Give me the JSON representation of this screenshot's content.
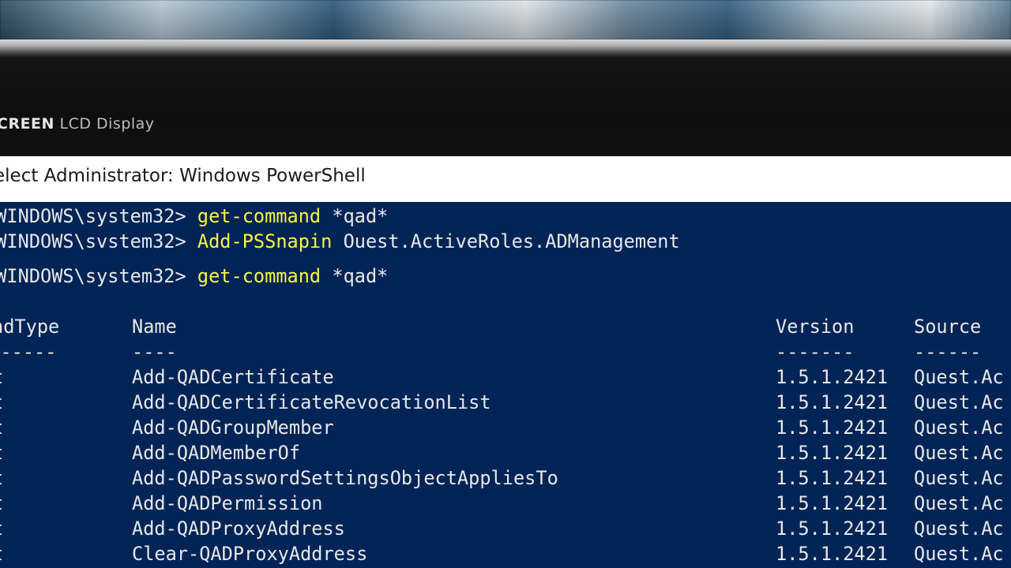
{
  "monitor": {
    "brand_strong": "CREEN",
    "brand_light": "LCD Display"
  },
  "window": {
    "title": "elect Administrator: Windows PowerShell"
  },
  "console": {
    "prompt": "\\WINDOWS\\system32> ",
    "prompt_blurred": "\\WINDOWS\\svstem32> ",
    "lines": [
      {
        "cmd": "get-command",
        "args": " *qad*"
      },
      {
        "cmd": "Add-PSSnapin",
        "args": " Ouest.ActiveRoles.ADManagement"
      },
      {
        "cmd": "get-command",
        "args": " *qad*"
      }
    ],
    "headers": {
      "type": "ndType",
      "name": "Name",
      "version": "Version",
      "source": "Source"
    },
    "underlines": {
      "type": "-------",
      "name": "----",
      "version": "-------",
      "source": "------"
    },
    "rows": [
      {
        "type": "t",
        "name": "Add-QADCertificate",
        "version": "1.5.1.2421",
        "source": "Quest.Ac"
      },
      {
        "type": "t",
        "name": "Add-QADCertificateRevocationList",
        "version": "1.5.1.2421",
        "source": "Quest.Ac"
      },
      {
        "type": "t",
        "name": "Add-QADGroupMember",
        "version": "1.5.1.2421",
        "source": "Quest.Ac"
      },
      {
        "type": "t",
        "name": "Add-QADMemberOf",
        "version": "1.5.1.2421",
        "source": "Quest.Ac"
      },
      {
        "type": "t",
        "name": "Add-QADPasswordSettingsObjectAppliesTo",
        "version": "1.5.1.2421",
        "source": "Quest.Ac"
      },
      {
        "type": "t",
        "name": "Add-QADPermission",
        "version": "1.5.1.2421",
        "source": "Quest.Ac"
      },
      {
        "type": "t",
        "name": "Add-QADProxyAddress",
        "version": "1.5.1.2421",
        "source": "Quest.Ac"
      },
      {
        "type": "t",
        "name": "Clear-QADProxyAddress",
        "version": "1.5.1.2421",
        "source": "Quest.Ac"
      }
    ]
  },
  "colors": {
    "console_bg": "#012456",
    "command": "#f6f645",
    "text": "#e8e8e8"
  }
}
